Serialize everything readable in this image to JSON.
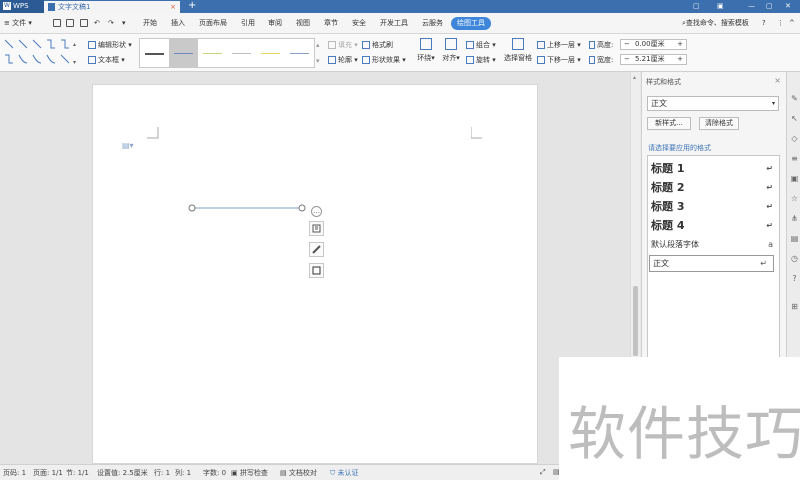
{
  "titlebar": {
    "app_tab": "WPS",
    "doc_tab": "文字文稿1",
    "close_glyph": "×",
    "add_glyph": "+"
  },
  "menubar": {
    "file": "文件",
    "tabs": [
      "开始",
      "插入",
      "页面布局",
      "引用",
      "审阅",
      "视图",
      "章节",
      "安全",
      "开发工具",
      "云服务"
    ],
    "active_tab": "绘图工具",
    "search": "查找命令、搜索模板"
  },
  "ribbon": {
    "edit_shape": "编辑形状",
    "text_box": "文本框",
    "fill": "填充",
    "outline": "轮廓",
    "format_painter": "格式刷",
    "shape_effects": "形状效果",
    "wrap": "环绕",
    "align": "对齐",
    "group": "组合",
    "rotate": "旋转",
    "selection_pane": "选择窗格",
    "bring_forward": "上移一层",
    "send_backward": "下移一层",
    "height_label": "高度:",
    "height_value": "0.00厘米",
    "width_label": "宽度:",
    "width_value": "5.21厘米",
    "line_colors": [
      "#555555",
      "#6b8cc2",
      "#c9d67a",
      "#bdbdbd",
      "#e8d86a",
      "#8aa0c8"
    ]
  },
  "taskpane": {
    "title": "样式和格式",
    "current_style": "正文",
    "new_style": "新样式...",
    "clear_format": "清除格式",
    "apply_label": "请选择要应用的格式",
    "styles": [
      {
        "name": "标题 1",
        "mark": "↵"
      },
      {
        "name": "标题 2",
        "mark": "↵"
      },
      {
        "name": "标题 3",
        "mark": "↵"
      },
      {
        "name": "标题 4",
        "mark": "↵"
      },
      {
        "name": "默认段落字体",
        "mark": "a"
      },
      {
        "name": "正文",
        "mark": "↵"
      }
    ]
  },
  "statusbar": {
    "page_num": "页码: 1",
    "page": "页面: 1/1",
    "section": "节: 1/1",
    "setting": "设置值: 2.5厘米",
    "row": "行: 1",
    "col": "列: 1",
    "words": "字数: 0",
    "spell": "拼写检查",
    "proof": "文档校对",
    "cert": "未认证"
  },
  "watermark": "软件技巧"
}
